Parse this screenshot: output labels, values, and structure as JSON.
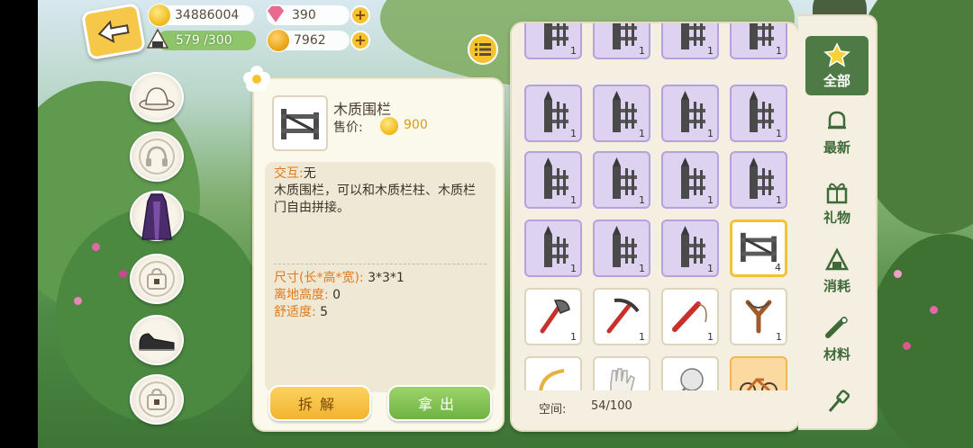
{
  "top_bar": {
    "coins": "34886004",
    "gems": "390",
    "stamina": "579 /300",
    "stamina_fill": 1.0,
    "tokens": "7962"
  },
  "detail": {
    "item_name": "木质围栏",
    "price_label": "售价:",
    "price_value": "900",
    "interaction_key": "交互:",
    "interaction_value": "无",
    "description": "木质围栏，可以和木质栏柱、木质栏门自由拼接。",
    "stats": [
      {
        "key": "尺寸(长*高*宽):",
        "value": "3*3*1"
      },
      {
        "key": "离地高度:",
        "value": "0"
      },
      {
        "key": "舒适度:",
        "value": "5"
      }
    ],
    "break_button": "拆解",
    "take_button": "拿出"
  },
  "inventory": {
    "space_label": "空间:",
    "space_value": "54/100",
    "slots": [
      {
        "icon": "fence-post-icon",
        "count": "1",
        "style": "purple"
      },
      {
        "icon": "fence-post-icon",
        "count": "1",
        "style": "purple"
      },
      {
        "icon": "fence-post-icon",
        "count": "1",
        "style": "purple"
      },
      {
        "icon": "fence-post-icon",
        "count": "1",
        "style": "purple"
      },
      {
        "icon": "fence-post-icon",
        "count": "1",
        "style": "purple"
      },
      {
        "icon": "fence-post-icon",
        "count": "1",
        "style": "purple"
      },
      {
        "icon": "fence-post-icon",
        "count": "1",
        "style": "purple"
      },
      {
        "icon": "fence-post-icon",
        "count": "1",
        "style": "purple"
      },
      {
        "icon": "fence-post-icon",
        "count": "1",
        "style": "purple"
      },
      {
        "icon": "fence-post-icon",
        "count": "1",
        "style": "purple"
      },
      {
        "icon": "fence-post-icon",
        "count": "1",
        "style": "purple"
      },
      {
        "icon": "fence-post-icon",
        "count": "1",
        "style": "purple"
      },
      {
        "icon": "fence-post-icon",
        "count": "1",
        "style": "purple"
      },
      {
        "icon": "fence-post-icon",
        "count": "1",
        "style": "purple"
      },
      {
        "icon": "fence-post-icon",
        "count": "1",
        "style": "purple"
      },
      {
        "icon": "wooden-fence-icon",
        "count": "4",
        "style": "selected"
      },
      {
        "icon": "axe-icon",
        "count": "1",
        "style": "white"
      },
      {
        "icon": "pickaxe-icon",
        "count": "1",
        "style": "white"
      },
      {
        "icon": "fishing-rod-icon",
        "count": "1",
        "style": "white"
      },
      {
        "icon": "slingshot-icon",
        "count": "1",
        "style": "white"
      },
      {
        "icon": "sickle-icon",
        "count": "",
        "style": "white"
      },
      {
        "icon": "glove-icon",
        "count": "",
        "style": "white"
      },
      {
        "icon": "bug-net-icon",
        "count": "",
        "style": "white"
      },
      {
        "icon": "bicycle-icon",
        "count": "",
        "style": "orange"
      }
    ]
  },
  "tabs": [
    {
      "label": "全部",
      "icon": "star-icon",
      "active": true
    },
    {
      "label": "最新",
      "icon": "bell-icon",
      "active": false
    },
    {
      "label": "礼物",
      "icon": "gift-icon",
      "active": false
    },
    {
      "label": "消耗",
      "icon": "riceball-icon",
      "active": false
    },
    {
      "label": "材料",
      "icon": "wood-icon",
      "active": false
    },
    {
      "label": "",
      "icon": "shovel-icon",
      "active": false
    }
  ],
  "equipment": [
    {
      "icon": "hat-icon"
    },
    {
      "icon": "headphones-icon"
    },
    {
      "icon": "outfit-icon"
    },
    {
      "icon": "locked-bag-icon"
    },
    {
      "icon": "shoes-icon"
    },
    {
      "icon": "locked-bag-icon"
    }
  ],
  "colors": {
    "accent_yellow": "#f5c230",
    "tab_active": "#4e7a46",
    "rare_slot": "#ddd2f0",
    "price_text": "#d79a1c"
  }
}
